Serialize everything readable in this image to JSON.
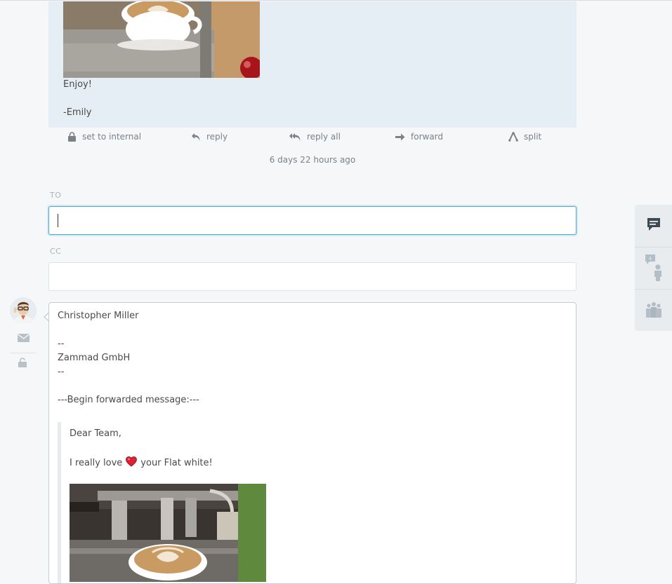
{
  "previous_article": {
    "closing": "Enjoy!",
    "signature": "-Emily",
    "image_alt": "coffee-cup-image"
  },
  "actions": [
    {
      "id": "set-internal",
      "label": "set to internal",
      "icon": "lock-icon"
    },
    {
      "id": "reply",
      "label": "reply",
      "icon": "reply-icon"
    },
    {
      "id": "reply-all",
      "label": "reply all",
      "icon": "reply-all-icon"
    },
    {
      "id": "forward",
      "label": "forward",
      "icon": "forward-icon"
    },
    {
      "id": "split",
      "label": "split",
      "icon": "split-icon"
    }
  ],
  "timestamp": "6 days 22 hours ago",
  "form": {
    "to_label": "TO",
    "to_value": "",
    "cc_label": "CC",
    "cc_value": ""
  },
  "editor": {
    "name": "Christopher Miller",
    "sig_sep1": "--",
    "company": "Zammad GmbH",
    "sig_sep2": "--",
    "forward_header": "---Begin forwarded message:---",
    "quote_greeting": "Dear Team,",
    "quote_text_before": "I really love",
    "quote_text_after": "your Flat white!"
  },
  "sidebar_icons": [
    "chat-icon",
    "customer-icon",
    "organization-icon"
  ],
  "colors": {
    "article_bg": "#e4eef4",
    "focus_border": "#4ba9d3",
    "heart": "#e02030"
  }
}
